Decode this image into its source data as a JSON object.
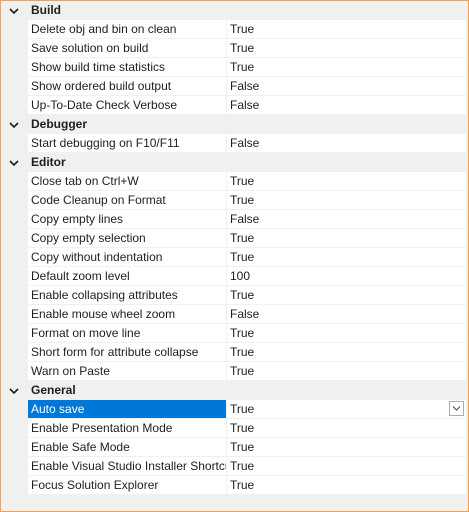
{
  "categories": [
    {
      "label": "Build",
      "rows": [
        {
          "name": "Delete obj and bin on clean",
          "value": "True"
        },
        {
          "name": "Save solution on build",
          "value": "True"
        },
        {
          "name": "Show build time statistics",
          "value": "True"
        },
        {
          "name": "Show ordered build output",
          "value": "False"
        },
        {
          "name": "Up-To-Date Check Verbose",
          "value": "False"
        }
      ]
    },
    {
      "label": "Debugger",
      "rows": [
        {
          "name": "Start debugging on F10/F11",
          "value": "False"
        }
      ]
    },
    {
      "label": "Editor",
      "rows": [
        {
          "name": "Close tab on Ctrl+W",
          "value": "True"
        },
        {
          "name": "Code Cleanup on Format",
          "value": "True"
        },
        {
          "name": "Copy empty lines",
          "value": "False"
        },
        {
          "name": "Copy empty selection",
          "value": "True"
        },
        {
          "name": "Copy without indentation",
          "value": "True"
        },
        {
          "name": "Default zoom level",
          "value": "100"
        },
        {
          "name": "Enable collapsing attributes",
          "value": "True"
        },
        {
          "name": "Enable mouse wheel zoom",
          "value": "False"
        },
        {
          "name": "Format on move line",
          "value": "True"
        },
        {
          "name": "Short form for attribute collapse",
          "value": "True"
        },
        {
          "name": "Warn on Paste",
          "value": "True"
        }
      ]
    },
    {
      "label": "General",
      "rows": [
        {
          "name": "Auto save",
          "value": "True",
          "selected": true
        },
        {
          "name": "Enable Presentation Mode",
          "value": "True"
        },
        {
          "name": "Enable Safe Mode",
          "value": "True"
        },
        {
          "name": "Enable Visual Studio Installer Shortcut",
          "value": "True"
        },
        {
          "name": "Focus Solution Explorer",
          "value": "True"
        }
      ]
    }
  ],
  "colors": {
    "accent_border": "#f5a04a",
    "selection": "#0078d7",
    "category_bg": "#f0f0f0"
  },
  "icons": {
    "collapse": "chevron-down-icon",
    "dropdown": "chevron-down-icon"
  }
}
